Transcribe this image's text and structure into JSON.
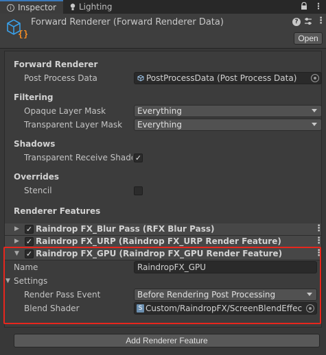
{
  "tabs": [
    {
      "label": "Inspector",
      "icon": "info-icon"
    },
    {
      "label": "Lighting",
      "icon": "bulb-icon"
    }
  ],
  "header": {
    "title": "Forward Renderer (Forward Renderer Data)",
    "open_label": "Open",
    "icon": "renderer-asset-icon"
  },
  "forward_renderer": {
    "heading": "Forward Renderer",
    "post_process_label": "Post Process Data",
    "post_process_value": "PostProcessData (Post Process Data)"
  },
  "filtering": {
    "heading": "Filtering",
    "opaque_label": "Opaque Layer Mask",
    "opaque_value": "Everything",
    "transparent_label": "Transparent Layer Mask",
    "transparent_value": "Everything"
  },
  "shadows": {
    "heading": "Shadows",
    "receive_label": "Transparent Receive Shadows",
    "receive_checked": true
  },
  "overrides": {
    "heading": "Overrides",
    "stencil_label": "Stencil",
    "stencil_checked": false
  },
  "renderer_features": {
    "heading": "Renderer Features",
    "items": [
      {
        "label": "Raindrop FX_Blur Pass (RFX Blur Pass)",
        "enabled": true,
        "expanded": false
      },
      {
        "label": "Raindrop FX_URP (Raindrop FX_URP Render Feature)",
        "enabled": true,
        "expanded": false
      },
      {
        "label": "Raindrop FX_GPU (Raindrop FX_GPU Render Feature)",
        "enabled": true,
        "expanded": true
      }
    ],
    "expanded": {
      "name_label": "Name",
      "name_value": "RaindropFX_GPU",
      "settings_label": "Settings",
      "event_label": "Render Pass Event",
      "event_value": "Before Rendering Post Processing",
      "shader_label": "Blend Shader",
      "shader_value": "Custom/RaindropFX/ScreenBlendEffect_GPU"
    },
    "add_label": "Add Renderer Feature"
  },
  "colors": {
    "highlight_border": "#e8261d",
    "active_tab_accent": "#3a79bb",
    "asset_icon_blue": "#3aa0e8",
    "asset_icon_orange": "#f08a24"
  }
}
